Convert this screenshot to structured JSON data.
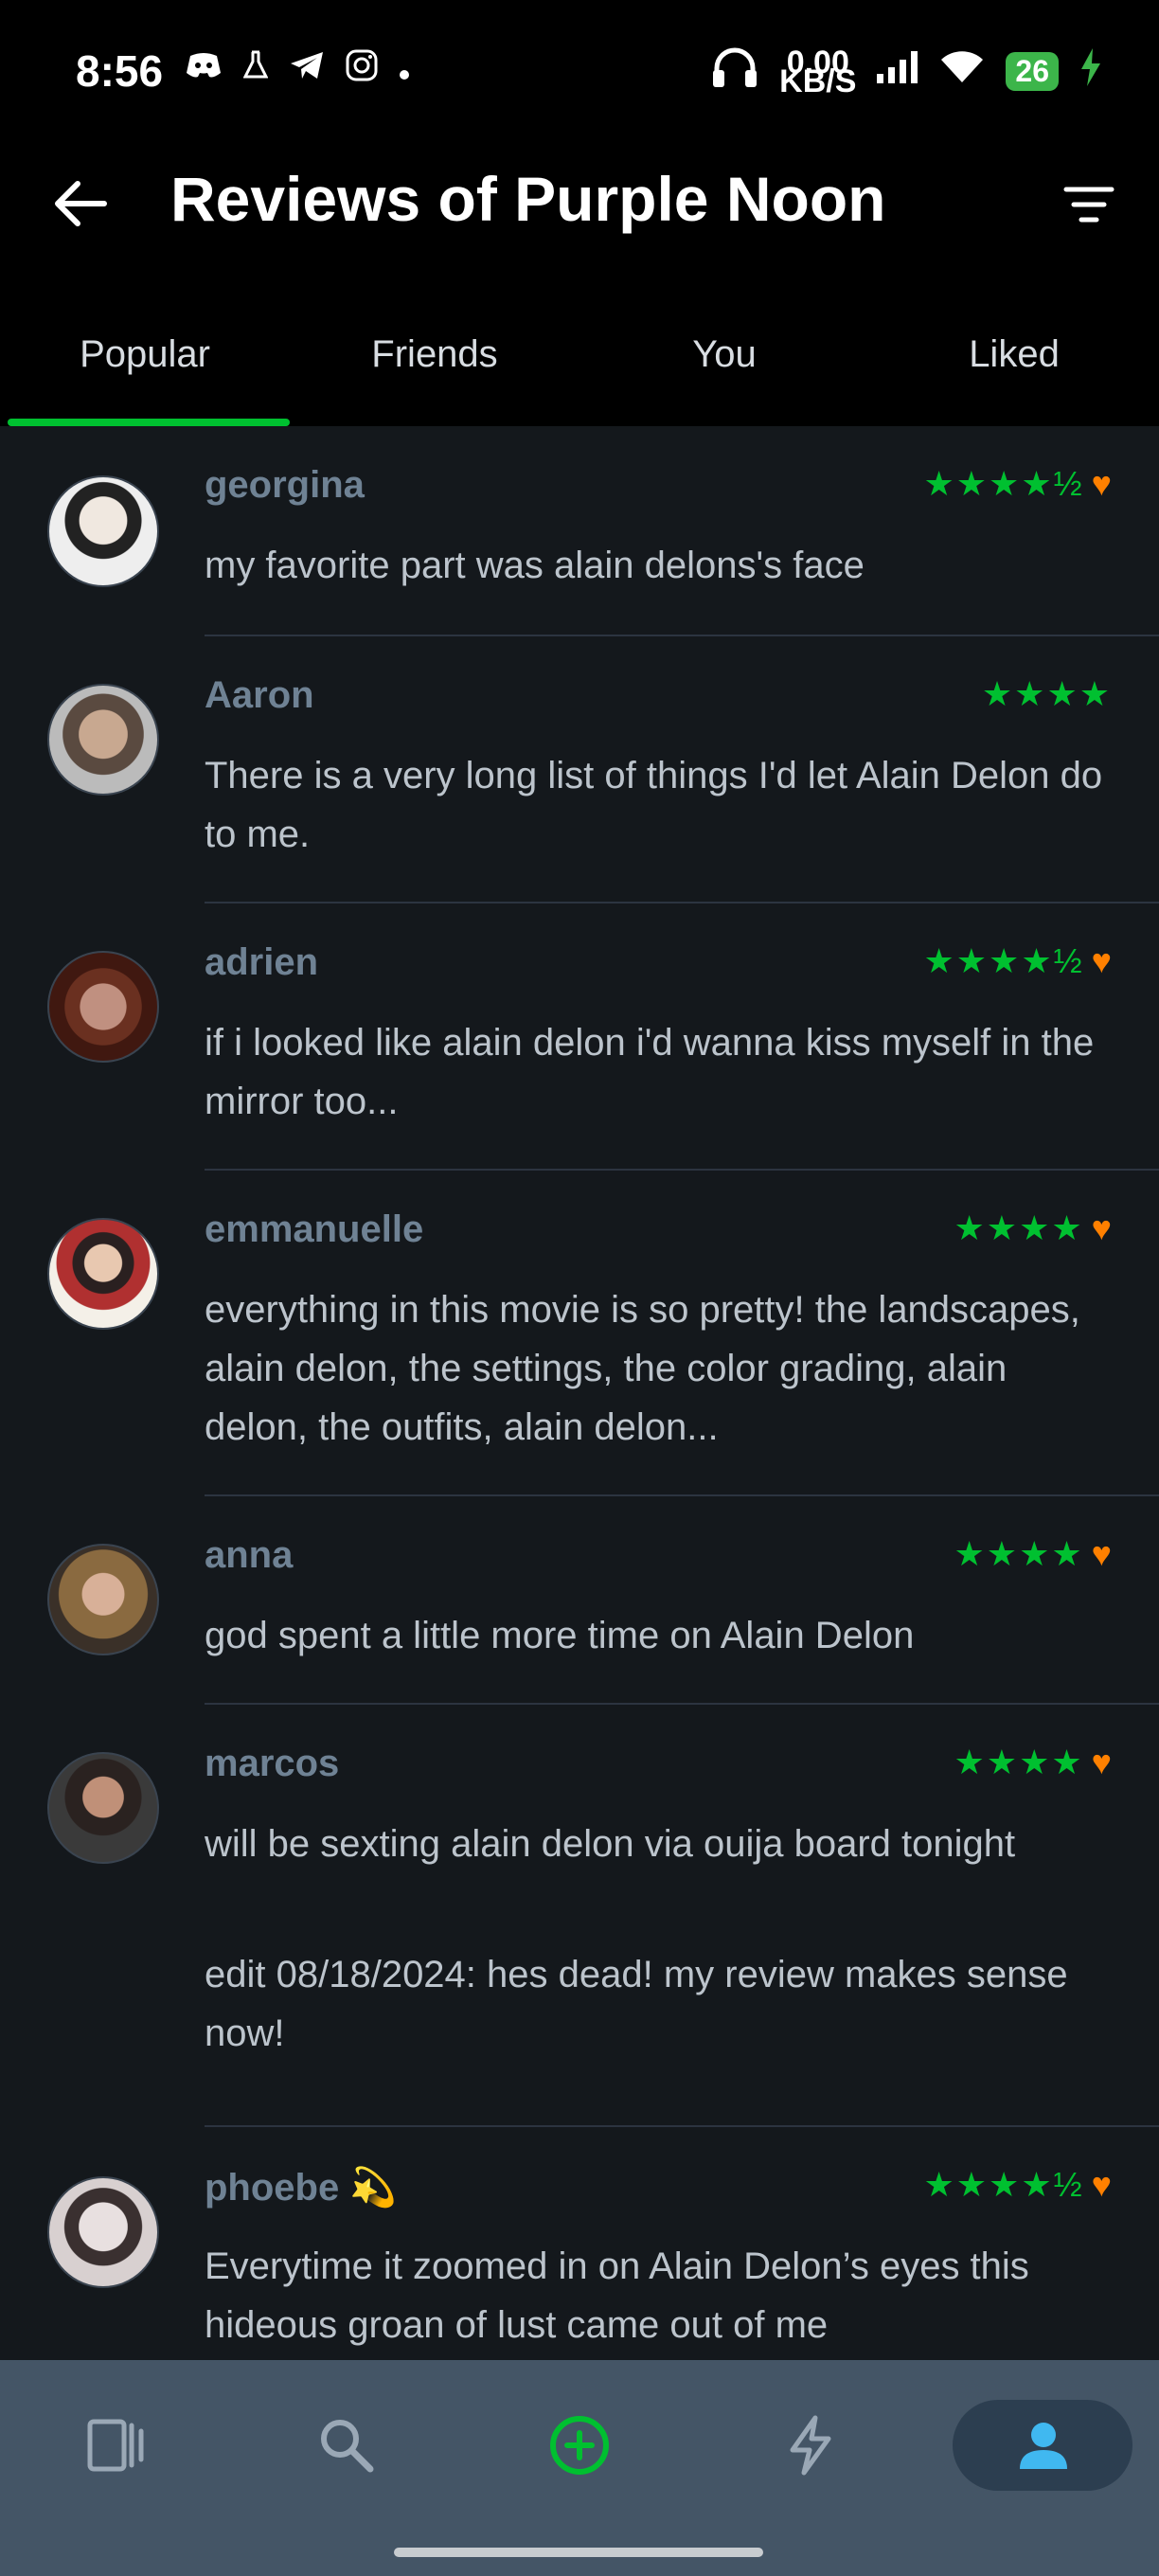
{
  "status": {
    "time": "8:56",
    "net_top": "0.00",
    "net_bottom": "KB/S",
    "battery": "26"
  },
  "header": {
    "title": "Reviews of Purple Noon"
  },
  "tabs": [
    "Popular",
    "Friends",
    "You",
    "Liked"
  ],
  "reviews": [
    {
      "name": "georgina",
      "stars": "★★★★½",
      "liked": true,
      "text": "my favorite part was alain delons's face"
    },
    {
      "name": "Aaron",
      "stars": "★★★★",
      "liked": false,
      "text": "There is a very long list of things I'd let Alain Delon do to me."
    },
    {
      "name": "adrien",
      "stars": "★★★★½",
      "liked": true,
      "text": "if i looked like alain delon i'd wanna kiss myself in the mirror too..."
    },
    {
      "name": "emmanuelle",
      "stars": "★★★★",
      "liked": true,
      "text": "everything in this movie is so pretty! the landscapes, alain delon, the settings, the color grading, alain delon, the outfits, alain delon..."
    },
    {
      "name": "anna",
      "stars": "★★★★",
      "liked": true,
      "text": "god spent a little more time on Alain Delon"
    },
    {
      "name": "marcos",
      "stars": "★★★★",
      "liked": true,
      "text": "will be sexting alain delon via ouija board tonight",
      "text2": "edit 08/18/2024: hes dead! my review makes sense now!"
    },
    {
      "name": "phoebe 💫",
      "stars": "★★★★½",
      "liked": true,
      "text": "Everytime it zoomed in on Alain Delon’s eyes this hideous groan of lust came out of me"
    }
  ],
  "heart_glyph": "♥",
  "colors": {
    "accent_green": "#00c030",
    "heart_orange": "#ff8000",
    "background": "#14181c",
    "nav_bg": "#445566"
  }
}
